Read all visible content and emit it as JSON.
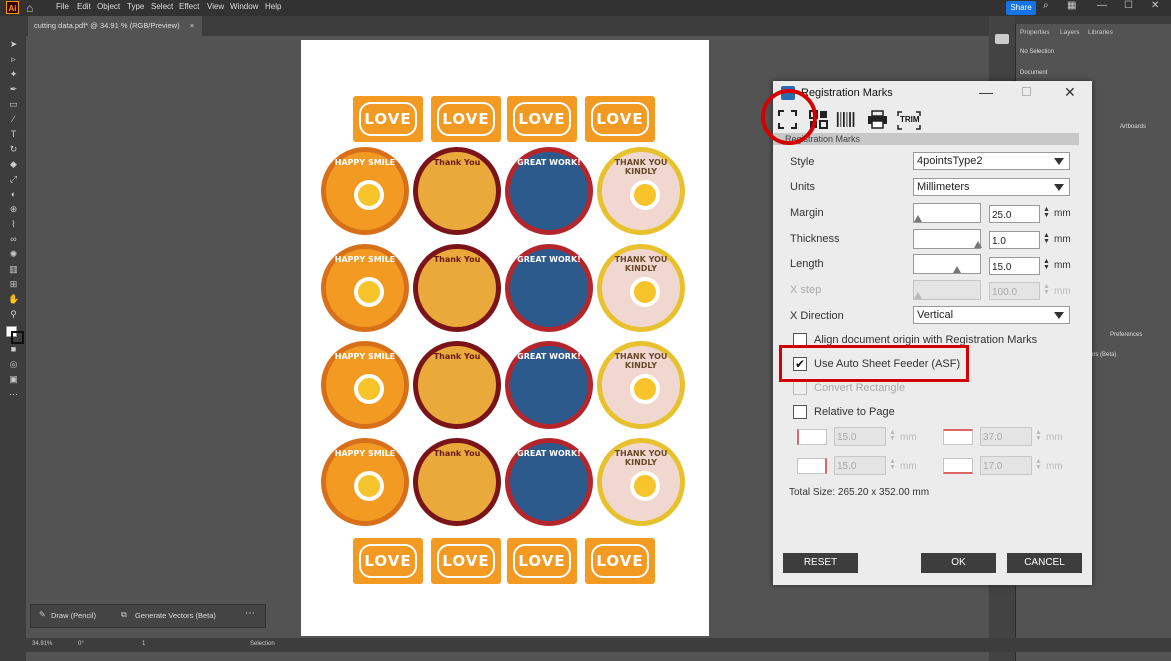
{
  "app": {
    "logo": "Ai"
  },
  "menu": [
    "File",
    "Edit",
    "Object",
    "Type",
    "Select",
    "Effect",
    "View",
    "Window",
    "Help"
  ],
  "share_label": "Share",
  "document_tab": {
    "title": "cutting data.pdf* @ 34.91 % (RGB/Preview)",
    "close": "×"
  },
  "panel": {
    "tabs": [
      "Properties",
      "Layers",
      "Libraries"
    ],
    "no_selection": "No Selection",
    "document_label": "Document",
    "artboards_label": "Artboards",
    "preferences_label": "Preferences",
    "generate_beta": "ors (Beta)"
  },
  "bottom_toolbar": {
    "draw_label": "Draw (Pencil)",
    "vectors_label": "Generate Vectors (Beta)"
  },
  "status": {
    "zoom": "34.91%",
    "angle": "0°",
    "artboard": "1",
    "tool": "Selection"
  },
  "stickers": {
    "love_text": "LOVE",
    "smile_text": "HAPPY SMILE",
    "thank_text": "Thank You",
    "great_text": "GREAT WORK!",
    "kindly_text": "THANK YOU KINDLY"
  },
  "dialog": {
    "title": "Registration Marks",
    "controls": {
      "minimize": "—",
      "maximize": "☐",
      "close": "✕"
    },
    "toolbar_trim": "TRIM",
    "section": "Registration Marks",
    "style_label": "Style",
    "style_value": "4pointsType2",
    "units_label": "Units",
    "units_value": "Millimeters",
    "margin_label": "Margin",
    "margin_value": "25.0",
    "thickness_label": "Thickness",
    "thickness_value": "1.0",
    "length_label": "Length",
    "length_value": "15.0",
    "xstep_label": "X step",
    "xstep_value": "100.0",
    "xdir_label": "X Direction",
    "xdir_value": "Vertical",
    "unit": "mm",
    "align_label": "Align document origin with Registration Marks",
    "asf_label": "Use Auto Sheet Feeder (ASF)",
    "asf_checked": "✔",
    "convert_label": "Convert Rectangle",
    "relative_label": "Relative to Page",
    "offset_top_left": "15.0",
    "offset_top_right": "37.0",
    "offset_bottom_left": "15.0",
    "offset_bottom_right": "17.0",
    "total_size": "Total Size: 265.20 x 352.00 mm",
    "reset": "RESET",
    "ok": "OK",
    "cancel": "CANCEL",
    "slider_levels": {
      "margin": 0.0,
      "thickness": 1.0,
      "length": 0.65,
      "xstep": 0.0
    }
  },
  "colors": {
    "highlight": "#d40000",
    "orange": "#f39a23",
    "maroon": "#7a1418",
    "blue": "#2d5a8c",
    "yellow": "#e8c22e"
  }
}
